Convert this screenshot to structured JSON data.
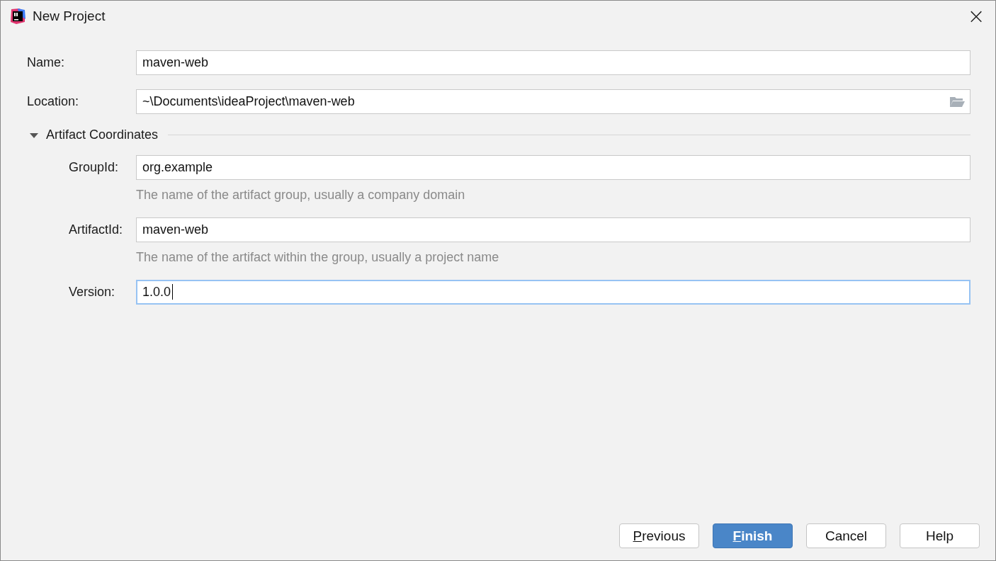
{
  "window": {
    "title": "New Project",
    "close": "×"
  },
  "fields": [
    {
      "label": "Name:",
      "value": "maven-web",
      "browse": false,
      "focused": false
    },
    {
      "label": "Location:",
      "value": "~\\Documents\\ideaProject\\maven-web",
      "browse": true,
      "focused": false
    }
  ],
  "section": {
    "title": "Artifact Coordinates",
    "expanded": true,
    "fields": [
      {
        "label": "GroupId:",
        "value": "org.example",
        "hint": "The name of the artifact group, usually a company domain",
        "focused": false
      },
      {
        "label": "ArtifactId:",
        "value": "maven-web",
        "hint": "The name of the artifact within the group, usually a project name",
        "focused": false
      },
      {
        "label": "Version:",
        "value": "1.0.0",
        "focused": true
      }
    ]
  },
  "buttons": [
    {
      "label": "Previous",
      "kind": "normal",
      "mnemonic": true
    },
    {
      "label": "Finish",
      "kind": "primary",
      "mnemonic": true
    },
    {
      "label": "Cancel",
      "kind": "normal",
      "mnemonic": false
    },
    {
      "label": "Help",
      "kind": "normal",
      "mnemonic": false
    }
  ]
}
